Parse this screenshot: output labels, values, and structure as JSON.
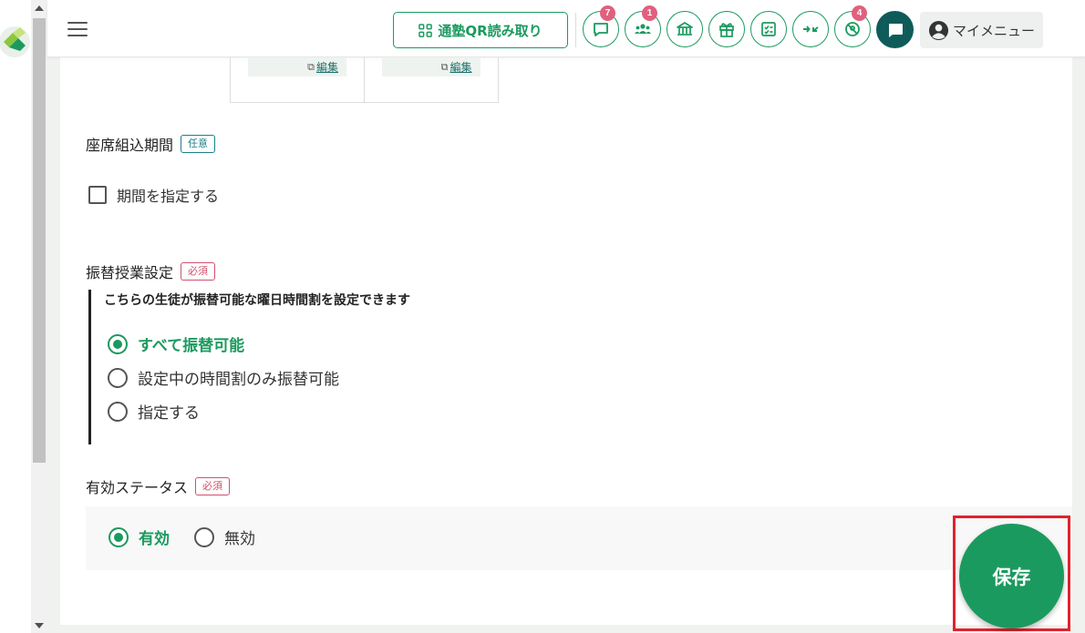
{
  "header": {
    "qr_button_label": "通塾QR読み取り",
    "icons": [
      {
        "name": "chat-bubble-icon",
        "badge": "7"
      },
      {
        "name": "users-icon",
        "badge": "1"
      },
      {
        "name": "bank-icon",
        "badge": ""
      },
      {
        "name": "gift-icon",
        "badge": ""
      },
      {
        "name": "checklist-icon",
        "badge": ""
      },
      {
        "name": "arrows-in-icon",
        "badge": ""
      },
      {
        "name": "location-off-icon",
        "badge": "4"
      },
      {
        "name": "chat-solid-icon",
        "badge": ""
      }
    ],
    "my_menu_label": "マイメニュー"
  },
  "images": {
    "edit_label_1": "編集",
    "edit_label_2": "編集"
  },
  "seat_period": {
    "label": "座席組込期間",
    "tag": "任意",
    "checkbox_label": "期間を指定する",
    "checked": false
  },
  "transfer": {
    "label": "振替授業設定",
    "tag": "必須",
    "description": "こちらの生徒が振替可能な曜日時間割を設定できます",
    "options": [
      {
        "label": "すべて振替可能",
        "selected": true
      },
      {
        "label": "設定中の時間割のみ振替可能",
        "selected": false
      },
      {
        "label": "指定する",
        "selected": false
      }
    ]
  },
  "status": {
    "label": "有効ステータス",
    "tag": "必須",
    "options": [
      {
        "label": "有効",
        "selected": true
      },
      {
        "label": "無効",
        "selected": false
      }
    ]
  },
  "save_label": "保存",
  "colors": {
    "primary": "#1b9a5f",
    "required_tag": "#d0506e",
    "optional_tag": "#1b7f8a",
    "highlight": "#e0222e",
    "dark_teal": "#0f5b5a"
  }
}
